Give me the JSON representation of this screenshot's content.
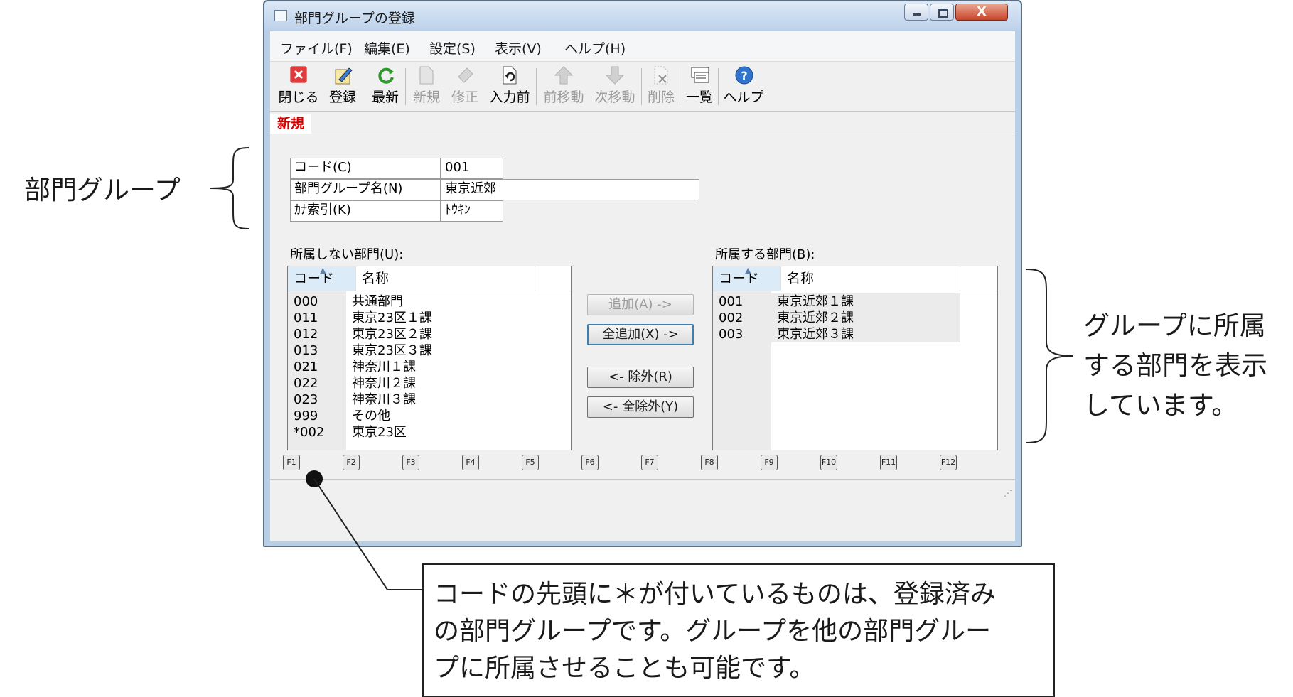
{
  "window": {
    "title": "部門グループの登録",
    "close_glyph": "X"
  },
  "menu": [
    "ファイル(F)",
    "編集(E)",
    "設定(S)",
    "表示(V)",
    "ヘルプ(H)"
  ],
  "toolbar": [
    {
      "label": "閉じる",
      "icon": "close-icon",
      "enabled": true
    },
    {
      "label": "登録",
      "icon": "register-icon",
      "enabled": true
    },
    {
      "label": "最新",
      "icon": "refresh-icon",
      "enabled": true
    },
    {
      "label": "新規",
      "icon": "new-icon",
      "enabled": false
    },
    {
      "label": "修正",
      "icon": "edit-icon",
      "enabled": false
    },
    {
      "label": "入力前",
      "icon": "undo-icon",
      "enabled": true
    },
    {
      "label": "前移動",
      "icon": "up-arrow-icon",
      "enabled": false
    },
    {
      "label": "次移動",
      "icon": "down-arrow-icon",
      "enabled": false
    },
    {
      "label": "削除",
      "icon": "delete-icon",
      "enabled": false
    },
    {
      "label": "一覧",
      "icon": "list-icon",
      "enabled": true
    },
    {
      "label": "ヘルプ",
      "icon": "help-icon",
      "enabled": true
    }
  ],
  "mode": "新規",
  "form": {
    "code_label": "コード(C)",
    "code_value": "001",
    "name_label": "部門グループ名(N)",
    "name_value": "東京近郊",
    "kana_label": "ｶﾅ索引(K)",
    "kana_value": "ﾄｳｷﾝ"
  },
  "unassigned": {
    "label": "所属しない部門(U):",
    "headers": [
      "コード",
      "名称"
    ],
    "rows": [
      [
        "000",
        "共通部門"
      ],
      [
        "011",
        "東京23区１課"
      ],
      [
        "012",
        "東京23区２課"
      ],
      [
        "013",
        "東京23区３課"
      ],
      [
        "021",
        "神奈川１課"
      ],
      [
        "022",
        "神奈川２課"
      ],
      [
        "023",
        "神奈川３課"
      ],
      [
        "999",
        "その他"
      ],
      [
        "*002",
        "東京23区"
      ]
    ]
  },
  "assigned": {
    "label": "所属する部門(B):",
    "headers": [
      "コード",
      "名称"
    ],
    "rows": [
      [
        "001",
        "東京近郊１課"
      ],
      [
        "002",
        "東京近郊２課"
      ],
      [
        "003",
        "東京近郊３課"
      ]
    ]
  },
  "buttons": {
    "add": "追加(A) ->",
    "add_all": "全追加(X) ->",
    "remove": "<- 除外(R)",
    "remove_all": "<- 全除外(Y)"
  },
  "fkeys": [
    "F1",
    "F2",
    "F3",
    "F4",
    "F5",
    "F6",
    "F7",
    "F8",
    "F9",
    "F10",
    "F11",
    "F12"
  ],
  "annotations": {
    "left_label": "部門グループ",
    "right_label": [
      "グループに所属",
      "する部門を表示",
      "しています。"
    ],
    "callout": [
      "コードの先頭に＊が付いているものは、登録済み",
      "の部門グループです。グループを他の部門グルー",
      "プに所属させることも可能です。"
    ]
  }
}
